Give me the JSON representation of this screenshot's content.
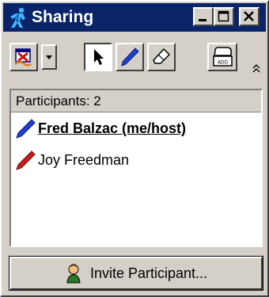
{
  "window": {
    "title": "Sharing",
    "title_icon": "sharing-figure-icon",
    "colors": {
      "titlebar": "#0a246a",
      "face": "#d4d0c8",
      "host_pen": "#1f3fd0",
      "guest_pen": "#cc1a1a"
    }
  },
  "toolbar": {
    "tools": [
      {
        "name": "sharing-control-icon"
      },
      {
        "name": "dropdown-arrow-icon"
      },
      {
        "name": "pointer-icon",
        "selected": true
      },
      {
        "name": "pen-icon"
      },
      {
        "name": "eraser-icon"
      },
      {
        "name": "stamp-icon",
        "badge": "ADD"
      },
      {
        "name": "collapse-icon"
      }
    ]
  },
  "participants": {
    "header": "Participants: 2",
    "list": [
      {
        "name": "Fred Balzac (me/host)",
        "icon": "blue-pen-icon",
        "is_host": true
      },
      {
        "name": "Joy Freedman",
        "icon": "red-pen-icon",
        "is_host": false
      }
    ]
  },
  "invite": {
    "label": "Invite Participant...",
    "icon": "person-icon"
  }
}
